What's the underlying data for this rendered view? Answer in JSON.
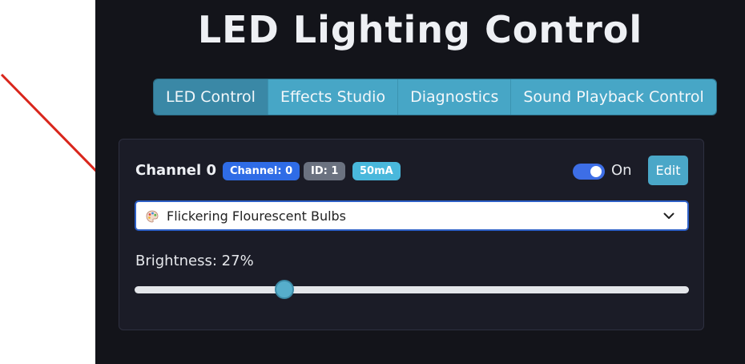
{
  "app": {
    "title": "LED Lighting Control"
  },
  "tabs": [
    {
      "label": "LED Control",
      "active": true
    },
    {
      "label": "Effects Studio",
      "active": false
    },
    {
      "label": "Diagnostics",
      "active": false
    },
    {
      "label": "Sound Playback Control",
      "active": false
    }
  ],
  "channel": {
    "title": "Channel 0",
    "badges": {
      "channel": "Channel: 0",
      "id": "ID: 1",
      "current": "50mA"
    },
    "power": {
      "label": "On",
      "enabled": true
    },
    "edit_label": "Edit",
    "effect": {
      "icon": "palette-icon",
      "selected": "Flickering Flourescent Bulbs"
    },
    "brightness": {
      "label": "Brightness: 27%",
      "value": 27
    }
  },
  "colors": {
    "background": "#13141a",
    "card": "#1b1c27",
    "tab": "#47a6c6",
    "tab_active": "#3a88a6",
    "accent_blue": "#2f6ce6",
    "annotation_arrow": "#d9261c"
  }
}
